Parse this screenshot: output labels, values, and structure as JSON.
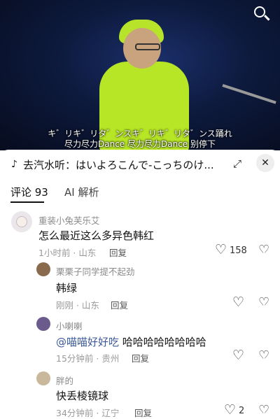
{
  "video": {
    "subtitle_line1": "キ゛リキ゛リタ゛ンスキ゛リキ゛リタ゛ンス踊れ",
    "subtitle_line2": "尽力尽力Dance 尽力尽力Dance 别停下",
    "search_icon": "search-icon"
  },
  "music_bar": {
    "icon": "music-note-icon",
    "text": "去汽水听：はいよろこんで-こっちのけ...",
    "expand_icon": "expand-icon",
    "close_icon": "close-icon"
  },
  "tabs": {
    "comments_label": "评论 93",
    "ai_label": "AI 解析"
  },
  "comments": [
    {
      "name": "重装小兔芙乐艾",
      "text": "怎么最近这么多异色韩红",
      "time_location": "1小时前 · 山东",
      "reply_label": "回复",
      "likes": "158"
    },
    {
      "name": "栗栗子同学提不起劲",
      "text": "韩绿",
      "time_location": "刚刚 · 山东",
      "reply_label": "回复"
    },
    {
      "name": "小喇喇",
      "mention": "@喵喵好好吃",
      "text": " 哈哈哈哈哈哈哈哈",
      "time_location": "15分钟前 · 贵州",
      "reply_label": "回复"
    },
    {
      "name": "胖的",
      "text": "快丢棱镜球",
      "time_location": "34分钟前 · 辽宁",
      "reply_label": "回复",
      "likes": "2"
    }
  ]
}
